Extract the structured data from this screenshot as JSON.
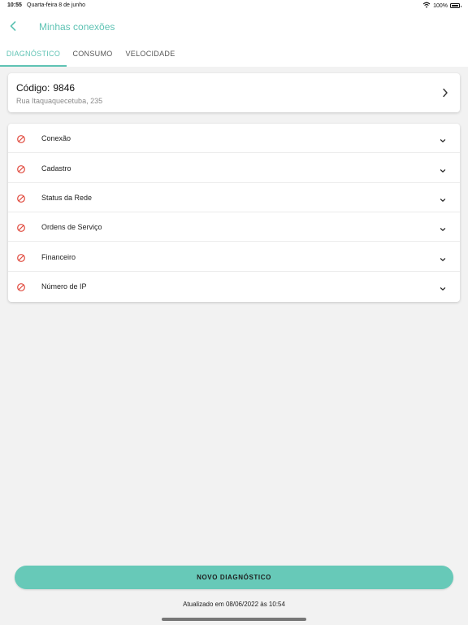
{
  "status_bar": {
    "time": "10:55",
    "date": "Quarta-feira 8 de junho",
    "battery": "100%"
  },
  "nav": {
    "title": "Minhas conexões",
    "back_icon": "chevron-left-icon"
  },
  "tabs": [
    {
      "label": "DIAGNÓSTICO",
      "active": true
    },
    {
      "label": "CONSUMO",
      "active": false
    },
    {
      "label": "VELOCIDADE",
      "active": false
    }
  ],
  "connection": {
    "code_label": "Código:",
    "code_value": "9846",
    "address": "Rua Itaquaquecetuba, 235"
  },
  "diagnostics": [
    {
      "label": "Conexão",
      "icon": "blocked-icon"
    },
    {
      "label": "Cadastro",
      "icon": "blocked-icon"
    },
    {
      "label": "Status da Rede",
      "icon": "blocked-icon"
    },
    {
      "label": "Ordens de Serviço",
      "icon": "blocked-icon"
    },
    {
      "label": "Financeiro",
      "icon": "blocked-icon"
    },
    {
      "label": "Número de IP",
      "icon": "blocked-icon"
    }
  ],
  "actions": {
    "new_diagnostic": "NOVO DIAGNÓSTICO"
  },
  "footer": {
    "updated": "Atualizado em 08/06/2022 às 10:54"
  },
  "colors": {
    "accent": "#5fc3b4",
    "button": "#67c9b8",
    "error_icon": "#e0483c",
    "background": "#f2f2f2"
  }
}
